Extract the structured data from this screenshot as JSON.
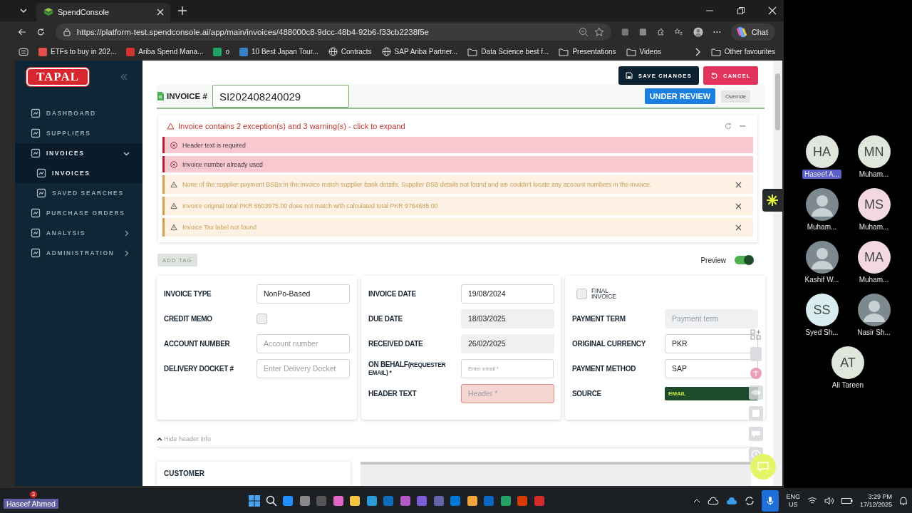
{
  "browser": {
    "tab_title": "SpendConsole",
    "url": "https://platform-test.spendconsole.ai/app/main/invoices/488000c8-9dcc-48b4-92b6-f33cb2238f5e",
    "chat_label": "Chat",
    "bookmarks": [
      {
        "label": "ETFs to buy in 202...",
        "kind": "site",
        "color": "#e0504a"
      },
      {
        "label": "Ariba Spend Mana...",
        "kind": "site",
        "color": "#d0342c"
      },
      {
        "label": "o",
        "kind": "site",
        "color": "#1fa463"
      },
      {
        "label": "10 Best Japan Tour...",
        "kind": "site",
        "color": "#3b82c4"
      },
      {
        "label": "Contracts",
        "kind": "globe"
      },
      {
        "label": "SAP Ariba Partner...",
        "kind": "globe"
      },
      {
        "label": "Data Science best f...",
        "kind": "folder"
      },
      {
        "label": "Presentations",
        "kind": "folder"
      },
      {
        "label": "Videos",
        "kind": "folder"
      }
    ],
    "other_favourites": "Other favourites"
  },
  "sidebar": {
    "logo": "TAPAL",
    "items": [
      {
        "label": "DASHBOARD",
        "selected": false
      },
      {
        "label": "SUPPLIERS",
        "selected": false
      },
      {
        "label": "INVOICES",
        "selected": true,
        "expanded": true,
        "children": [
          {
            "label": "INVOICES",
            "selected": true
          },
          {
            "label": "SAVED SEARCHES",
            "selected": false
          }
        ]
      },
      {
        "label": "PURCHASE ORDERS",
        "selected": false
      },
      {
        "label": "ANALYSIS",
        "selected": false,
        "expanded": false
      },
      {
        "label": "ADMINISTRATION",
        "selected": false,
        "expanded": false
      }
    ]
  },
  "actions": {
    "save": "SAVE CHANGES",
    "cancel": "CANCEL"
  },
  "invoice": {
    "label": "INVOICE #",
    "number": "SI202408240029",
    "status": "UNDER REVIEW",
    "override": "Override"
  },
  "alerts": {
    "summary": "Invoice contains 2 exception(s) and 3 warning(s) - click to expand",
    "items": [
      {
        "kind": "error",
        "text": "Header text is required"
      },
      {
        "kind": "error",
        "text": "Invoice number already used"
      },
      {
        "kind": "warning",
        "text": "None of the supplier payment BSBs in the invoice match supplier bank details. Supplier BSB details not found and we couldn't locate any account numbers in the invoice."
      },
      {
        "kind": "warning",
        "text": "Invoice original total PKR 6603975.00 does not match with calculated total PKR 9764685.00"
      },
      {
        "kind": "warning",
        "text": "Invoice Tax label not found"
      }
    ]
  },
  "add_tag": "ADD TAG",
  "preview": {
    "label": "Preview",
    "on": true
  },
  "form_columns": [
    [
      {
        "kind": "input",
        "label": "INVOICE TYPE",
        "value": "NonPo-Based"
      },
      {
        "kind": "checkbox",
        "label": "CREDIT MEMO",
        "checked": false
      },
      {
        "kind": "input",
        "label": "ACCOUNT NUMBER",
        "placeholder": "Account number"
      },
      {
        "kind": "input",
        "label": "DELIVERY DOCKET #",
        "placeholder": "Enter Delivery Docket"
      }
    ],
    [
      {
        "kind": "input",
        "label": "INVOICE DATE",
        "value": "19/08/2024"
      },
      {
        "kind": "readonly",
        "label": "DUE DATE",
        "value": "18/03/2025"
      },
      {
        "kind": "readonly",
        "label": "RECEIVED DATE",
        "value": "26/02/2025"
      },
      {
        "kind": "input",
        "label": "ON BEHALF",
        "note": "(REQUESTER EMAIL) *",
        "placeholder": "Enter email *",
        "small": true
      },
      {
        "kind": "input",
        "label": "HEADER TEXT",
        "placeholder": "Header *",
        "error": true
      }
    ],
    [
      {
        "kind": "check_only",
        "label": "FINAL INVOICE",
        "checked": false
      },
      {
        "kind": "readonly",
        "label": "PAYMENT TERM",
        "placeholder": "Payment term"
      },
      {
        "kind": "input",
        "label": "ORIGINAL CURRENCY",
        "value": "PKR"
      },
      {
        "kind": "input",
        "label": "PAYMENT METHOD",
        "value": "SAP"
      },
      {
        "kind": "badge",
        "label": "SOURCE",
        "value": "EMAIL"
      }
    ]
  ],
  "hide_header": "Hide header info",
  "customer": "CUSTOMER",
  "participants": [
    {
      "initials": "HA",
      "name": "Haseef A...",
      "kind": "initials",
      "color": "#dfe6dc",
      "highlighted": true
    },
    {
      "initials": "MN",
      "name": "Muham...",
      "kind": "initials",
      "color": "#dfe6dc",
      "highlighted": false
    },
    {
      "name": "Muham...",
      "kind": "photo",
      "highlighted": false
    },
    {
      "initials": "MS",
      "name": "Muham...",
      "kind": "initials",
      "color": "#f3d7e2",
      "highlighted": false
    },
    {
      "name": "Kashif W...",
      "kind": "photo",
      "highlighted": false
    },
    {
      "initials": "MA",
      "name": "Muham...",
      "kind": "initials",
      "color": "#f3d7e2",
      "highlighted": false
    },
    {
      "initials": "SS",
      "name": "Syed Sh...",
      "kind": "initials",
      "color": "#d9ecef",
      "highlighted": false
    },
    {
      "name": "Nasir Sh...",
      "kind": "photo",
      "highlighted": false
    },
    {
      "initials": "AT",
      "name": "Ali Tareen",
      "kind": "initials",
      "color": "#dfe6dc",
      "highlighted": false
    }
  ],
  "taskbar": {
    "user": "Haseef Ahmed",
    "badge": "3",
    "lang": "ENG",
    "region": "US",
    "time": "3:29 PM",
    "date": "17/12/2025"
  }
}
